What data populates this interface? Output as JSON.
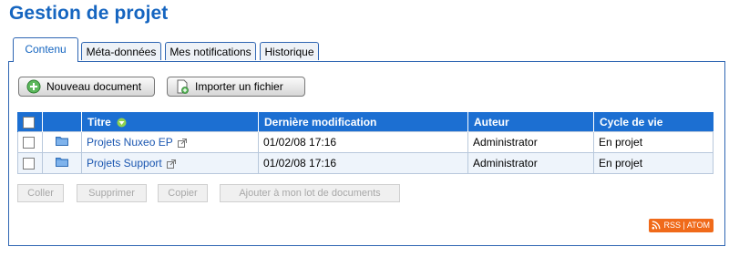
{
  "page": {
    "title": "Gestion de projet"
  },
  "tabs": [
    {
      "label": "Contenu",
      "active": true
    },
    {
      "label": "Méta-données",
      "active": false
    },
    {
      "label": "Mes notifications",
      "active": false
    },
    {
      "label": "Historique",
      "active": false
    }
  ],
  "toolbar": {
    "new_document": "Nouveau document",
    "import_file": "Importer un fichier"
  },
  "table": {
    "columns": {
      "title": "Titre",
      "modified": "Dernière modification",
      "author": "Auteur",
      "lifecycle": "Cycle de vie"
    },
    "rows": [
      {
        "title": "Projets Nuxeo EP",
        "modified": "01/02/08 17:16",
        "author": "Administrator",
        "lifecycle": "En projet",
        "icon": "folder-icon"
      },
      {
        "title": "Projets Support",
        "modified": "01/02/08 17:16",
        "author": "Administrator",
        "lifecycle": "En projet",
        "icon": "folder-icon"
      }
    ]
  },
  "actions": {
    "paste": "Coller",
    "delete": "Supprimer",
    "copy": "Copier",
    "add_to_worklist": "Ajouter à mon lot de documents"
  },
  "feed": {
    "label": "RSS | ATOM"
  },
  "colors": {
    "accent": "#1565c0",
    "header": "#1c6fd2",
    "rss": "#f06a1a"
  }
}
